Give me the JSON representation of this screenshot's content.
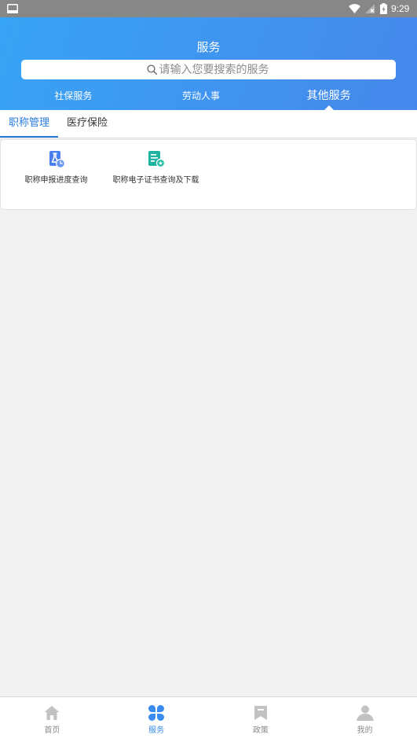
{
  "status_bar": {
    "time": "9:29",
    "icons": [
      "screen-cast-icon",
      "wifi-icon",
      "no-sim-signal-icon",
      "battery-charging-icon"
    ]
  },
  "header": {
    "title": "服务",
    "search_placeholder": "请输入您要搜索的服务"
  },
  "category_tabs": [
    {
      "label": "社保服务",
      "active": false
    },
    {
      "label": "劳动人事",
      "active": false
    },
    {
      "label": "其他服务",
      "active": true
    }
  ],
  "sub_tabs": [
    {
      "label": "职称管理",
      "active": true
    },
    {
      "label": "医疗保险",
      "active": false
    }
  ],
  "services": [
    {
      "label": "职称申报进度查询",
      "icon": "progress-query-icon"
    },
    {
      "label": "职称电子证书查询及下载",
      "icon": "certificate-icon"
    }
  ],
  "bottom_nav": [
    {
      "label": "首页",
      "icon": "home-icon",
      "active": false
    },
    {
      "label": "服务",
      "icon": "services-icon",
      "active": true
    },
    {
      "label": "政策",
      "icon": "policy-icon",
      "active": false
    },
    {
      "label": "我的",
      "icon": "profile-icon",
      "active": false
    }
  ],
  "colors": {
    "header_gradient_start": "#38a4f5",
    "header_gradient_end": "#4687eb",
    "sub_tab_accent": "#2a7be0",
    "nav_accent": "#3b8cf0",
    "progress_icon": "#4b7ff0",
    "certificate_icon": "#1fb3a1",
    "inactive_icon": "#c2c2c2"
  }
}
